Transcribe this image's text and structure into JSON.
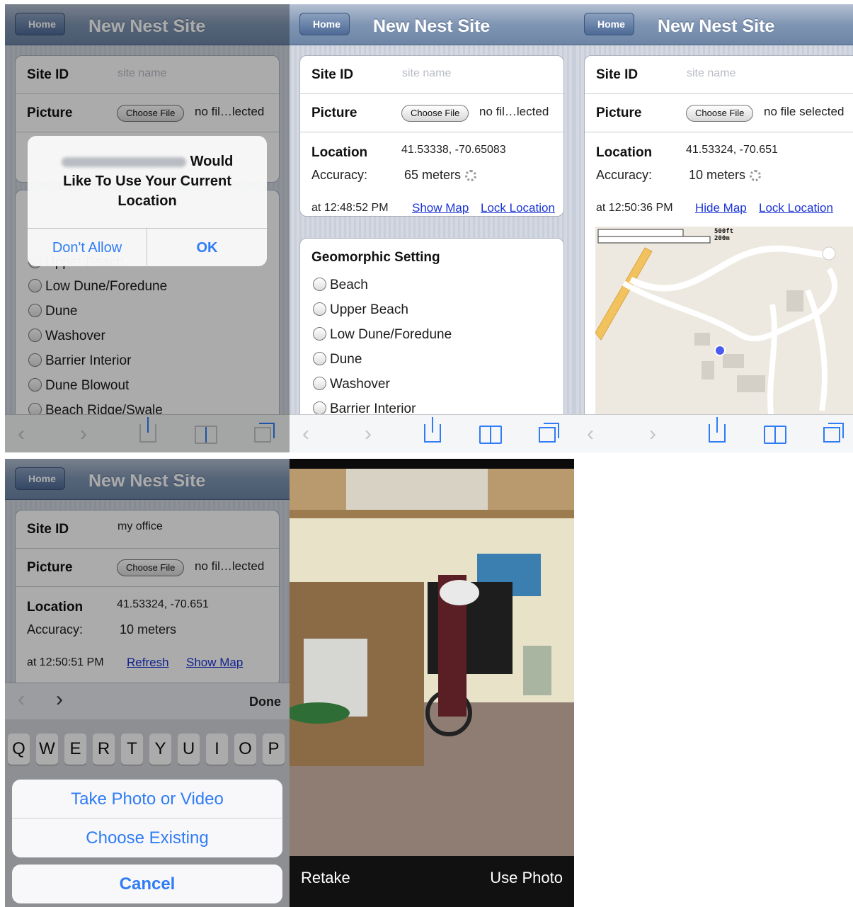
{
  "nav": {
    "home_label": "Home",
    "title": "New Nest Site"
  },
  "form": {
    "site_id_label": "Site ID",
    "site_id_placeholder": "site name",
    "picture_label": "Picture",
    "choose_file_label": "Choose File",
    "file_status_truncated": "no fil…lected",
    "file_status_full": "no file selected",
    "location_label": "Location",
    "accuracy_label": "Accuracy:"
  },
  "alert": {
    "message_suffix": "Would",
    "message_rest": "Like To Use Your Current Location",
    "dont_allow_label": "Don't Allow",
    "ok_label": "OK"
  },
  "panel1": {
    "radio_items": [
      "Upper Beach",
      "Low Dune/Foredune",
      "Dune",
      "Washover",
      "Barrier Interior",
      "Dune Blowout",
      "Beach Ridge/Swale"
    ]
  },
  "panel2": {
    "coords": "41.53338, -70.65083",
    "accuracy": "65 meters",
    "timestamp": "at 12:48:52 PM",
    "show_map_label": "Show Map",
    "lock_location_label": "Lock Location",
    "geomorphic_title": "Geomorphic Setting",
    "radio_items": [
      "Beach",
      "Upper Beach",
      "Low Dune/Foredune",
      "Dune",
      "Washover",
      "Barrier Interior"
    ]
  },
  "panel3": {
    "coords": "41.53324, -70.651",
    "accuracy": "10 meters",
    "timestamp": "at 12:50:36 PM",
    "hide_map_label": "Hide Map",
    "lock_location_label": "Lock Location",
    "scale_ft": "500ft",
    "scale_m": "200m"
  },
  "panel4": {
    "site_id_value": "my office",
    "coords": "41.53324, -70.651",
    "accuracy": "10 meters",
    "timestamp": "at 12:50:51 PM",
    "refresh_label": "Refresh",
    "show_map_label": "Show Map",
    "done_label": "Done",
    "keys": [
      "Q",
      "W",
      "E",
      "R",
      "T",
      "Y",
      "U",
      "I",
      "O",
      "P"
    ],
    "take_photo_label": "Take Photo or Video",
    "choose_existing_label": "Choose Existing",
    "cancel_label": "Cancel"
  },
  "panel5": {
    "retake_label": "Retake",
    "use_photo_label": "Use Photo"
  },
  "colors": {
    "ios_blue": "#2f7cf6",
    "link_blue": "#1b34d6",
    "nav_bar": "#7f95b3"
  }
}
